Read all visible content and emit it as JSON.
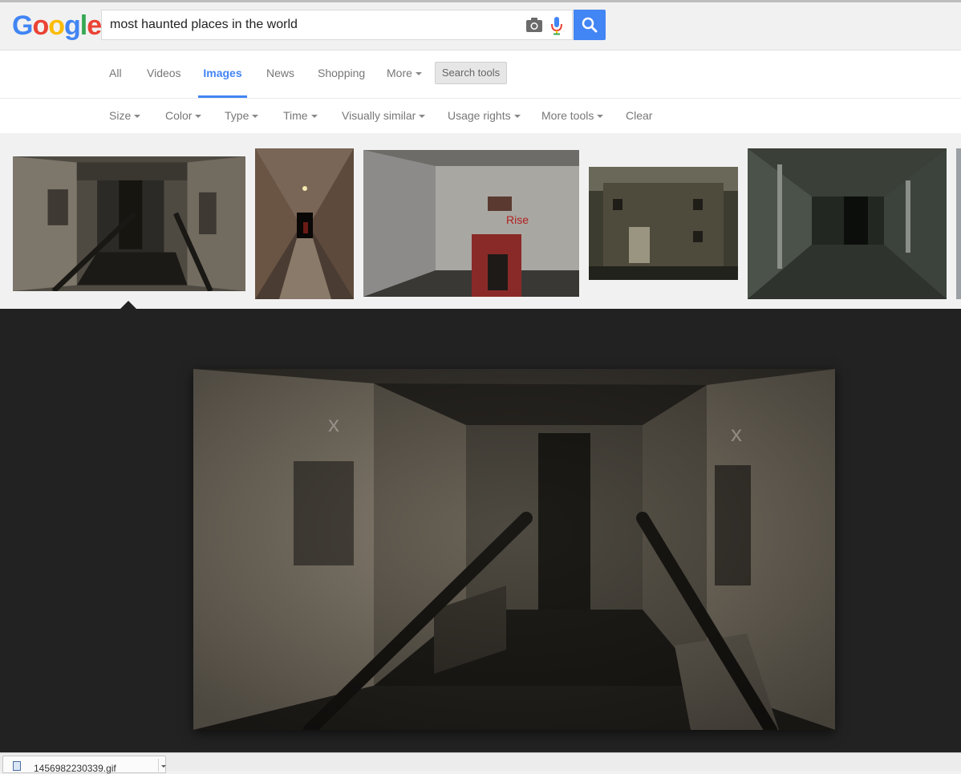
{
  "logo": {
    "text": "Google",
    "letters": [
      "G",
      "o",
      "o",
      "g",
      "l",
      "e"
    ],
    "colors": [
      "#4285f4",
      "#ea4335",
      "#fbbc05",
      "#4285f4",
      "#34a853",
      "#ea4335"
    ]
  },
  "search": {
    "query": "most haunted places in the world"
  },
  "icons": {
    "camera": "camera-icon",
    "mic": "mic-icon",
    "search": "search-icon"
  },
  "tabs": [
    "All",
    "Videos",
    "Images",
    "News",
    "Shopping",
    "More"
  ],
  "active_tab": "Images",
  "search_tools_label": "Search tools",
  "tools": [
    "Size",
    "Color",
    "Type",
    "Time",
    "Visually similar",
    "Usage rights",
    "More tools",
    "Clear"
  ],
  "download": {
    "filename": "1456982230339.gif"
  },
  "colors": {
    "accent": "#4285f4",
    "viewer_bg": "#222222"
  }
}
